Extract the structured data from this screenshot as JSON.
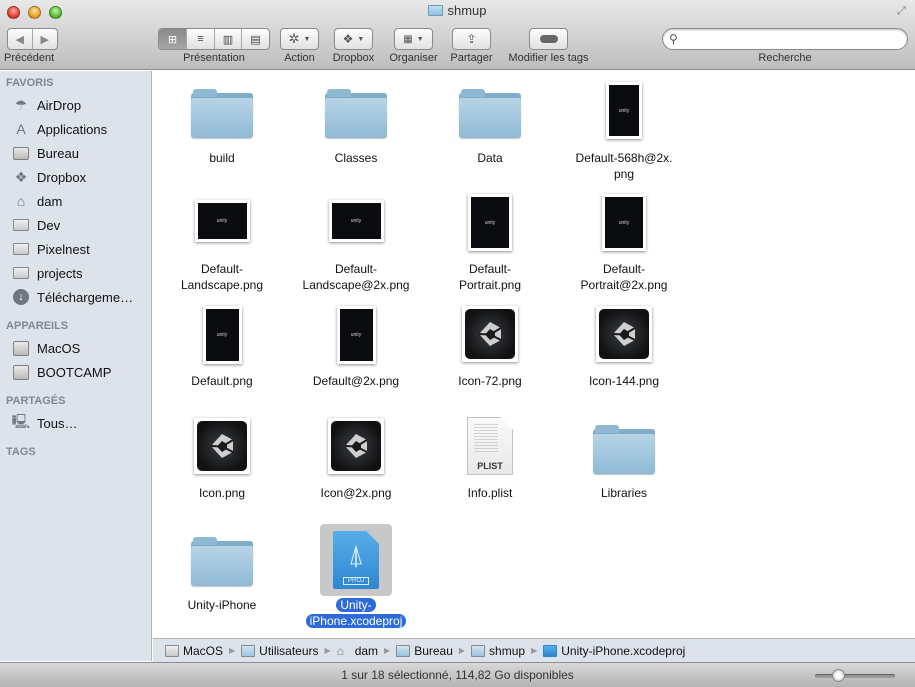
{
  "window": {
    "title": "shmup",
    "fullscreen_icon": "fullscreen-icon"
  },
  "toolbar": {
    "back_label": "Précédent",
    "presentation_label": "Présentation",
    "action_label": "Action",
    "dropbox_label": "Dropbox",
    "organise_label": "Organiser",
    "share_label": "Partager",
    "tags_label": "Modifier les tags",
    "search_label": "Recherche",
    "search_value": "",
    "search_placeholder": "",
    "view_modes": [
      "icon",
      "list",
      "columns",
      "cover-flow"
    ],
    "active_view": "icon"
  },
  "sidebar": {
    "sections": [
      {
        "title": "FAVORIS",
        "items": [
          {
            "label": "AirDrop",
            "icon": "airdrop-icon"
          },
          {
            "label": "Applications",
            "icon": "applications-icon"
          },
          {
            "label": "Bureau",
            "icon": "desktop-icon"
          },
          {
            "label": "Dropbox",
            "icon": "dropbox-icon"
          },
          {
            "label": "dam",
            "icon": "home-icon"
          },
          {
            "label": "Dev",
            "icon": "folder-icon"
          },
          {
            "label": "Pixelnest",
            "icon": "folder-icon"
          },
          {
            "label": "projects",
            "icon": "folder-icon"
          },
          {
            "label": "Téléchargeme…",
            "icon": "downloads-icon"
          }
        ]
      },
      {
        "title": "APPAREILS",
        "items": [
          {
            "label": "MacOS",
            "icon": "disk-icon"
          },
          {
            "label": "BOOTCAMP",
            "icon": "disk-icon"
          }
        ]
      },
      {
        "title": "PARTAGÉS",
        "items": [
          {
            "label": "Tous…",
            "icon": "network-icon"
          }
        ]
      },
      {
        "title": "TAGS",
        "items": []
      }
    ]
  },
  "files": [
    {
      "name": "build",
      "kind": "folder"
    },
    {
      "name": "Classes",
      "kind": "folder"
    },
    {
      "name": "Data",
      "kind": "folder"
    },
    {
      "name": "Default-568h@2x.\npng",
      "line1": "Default-568h@2x.",
      "line2": "png",
      "kind": "png-portrait"
    },
    {
      "name": "Default-Landscape.png",
      "line1": "Default-",
      "line2": "Landscape.png",
      "kind": "png-landscape"
    },
    {
      "name": "Default-Landscape@2x.png",
      "line1": "Default-",
      "line2": "Landscape@2x.png",
      "kind": "png-landscape"
    },
    {
      "name": "Default-Portrait.png",
      "line1": "Default-",
      "line2": "Portrait.png",
      "kind": "png-portrait"
    },
    {
      "name": "Default-Portrait@2x.png",
      "line1": "Default-",
      "line2": "Portrait@2x.png",
      "kind": "png-portrait"
    },
    {
      "name": "Default.png",
      "kind": "png-portrait"
    },
    {
      "name": "Default@2x.png",
      "kind": "png-portrait"
    },
    {
      "name": "Icon-72.png",
      "kind": "unity-icon"
    },
    {
      "name": "Icon-144.png",
      "kind": "unity-icon"
    },
    {
      "name": "Icon.png",
      "kind": "unity-icon"
    },
    {
      "name": "Icon@2x.png",
      "kind": "unity-icon"
    },
    {
      "name": "Info.plist",
      "kind": "plist",
      "badge": "PLIST"
    },
    {
      "name": "Libraries",
      "kind": "folder"
    },
    {
      "name": "Unity-iPhone",
      "kind": "folder"
    },
    {
      "name": "Unity-iPhone.xcodeproj",
      "line1": "Unity-",
      "line2": "iPhone.xcodeproj",
      "kind": "xcodeproj",
      "badge": "PROJ",
      "selected": true
    }
  ],
  "thumb_caption": "unity",
  "pathbar": [
    {
      "label": "MacOS",
      "icon": "disk-icon"
    },
    {
      "label": "Utilisateurs",
      "icon": "users-folder-icon"
    },
    {
      "label": "dam",
      "icon": "home-icon"
    },
    {
      "label": "Bureau",
      "icon": "desktop-folder-icon"
    },
    {
      "label": "shmup",
      "icon": "folder-icon"
    },
    {
      "label": "Unity-iPhone.xcodeproj",
      "icon": "xcodeproj-icon"
    }
  ],
  "status": {
    "text": "1 sur 18 sélectionné, 114,82 Go disponibles",
    "icon_size_slider": 0.25
  }
}
